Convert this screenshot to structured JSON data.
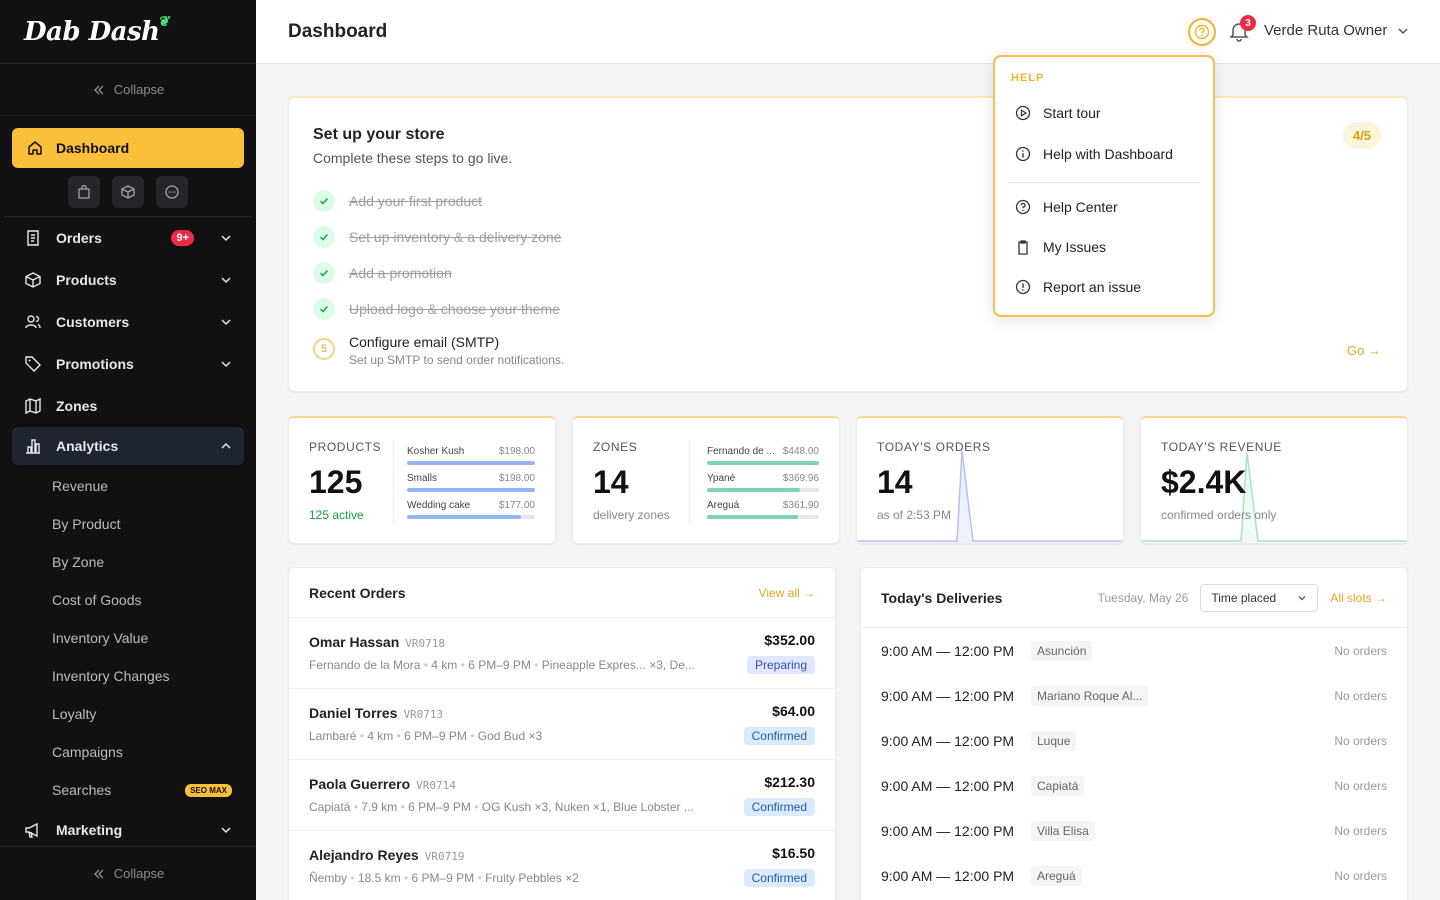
{
  "app": {
    "logo": "Dab Dash"
  },
  "sidebar": {
    "collapse_label": "Collapse",
    "dashboard_label": "Dashboard",
    "orders_label": "Orders",
    "orders_badge": "9+",
    "products_label": "Products",
    "customers_label": "Customers",
    "promotions_label": "Promotions",
    "zones_label": "Zones",
    "analytics_label": "Analytics",
    "analytics_items": [
      "Revenue",
      "By Product",
      "By Zone",
      "Cost of Goods",
      "Inventory Value",
      "Inventory Changes",
      "Loyalty",
      "Campaigns",
      "Searches"
    ],
    "searches_badge": "SEO MAX",
    "marketing_label": "Marketing"
  },
  "header": {
    "title": "Dashboard",
    "notifications_count": "3",
    "user": "Verde Ruta Owner"
  },
  "help_menu": {
    "header": "HELP",
    "items": [
      "Start tour",
      "Help with Dashboard",
      "Help Center",
      "My Issues",
      "Report an issue"
    ]
  },
  "setup": {
    "title": "Set up your store",
    "subtitle": "Complete these steps to go live.",
    "progress": "4/5",
    "steps": [
      "Add your first product",
      "Set up inventory & a delivery zone",
      "Add a promotion",
      "Upload logo & choose your theme"
    ],
    "pending_number": "5",
    "pending_title": "Configure email (SMTP)",
    "pending_desc": "Set up SMTP to send order notifications.",
    "go_label": "Go →"
  },
  "stats": {
    "products": {
      "caption": "PRODUCTS",
      "value": "125",
      "note": "125 active",
      "top": [
        {
          "name": "Kosher Kush",
          "value": "$198.00",
          "pct": 1.0
        },
        {
          "name": "Smalls",
          "value": "$198.00",
          "pct": 1.0
        },
        {
          "name": "Wedding cake",
          "value": "$177.00",
          "pct": 0.89
        }
      ]
    },
    "zones": {
      "caption": "ZONES",
      "value": "14",
      "note": "delivery zones",
      "top": [
        {
          "name": "Fernando de ...",
          "value": "$448.00",
          "pct": 1.0
        },
        {
          "name": "Ypané",
          "value": "$369.96",
          "pct": 0.83
        },
        {
          "name": "Areguá",
          "value": "$361.90",
          "pct": 0.81
        }
      ]
    },
    "orders": {
      "caption": "TODAY'S ORDERS",
      "value": "14",
      "note": "as of 2:53 PM"
    },
    "revenue": {
      "caption": "TODAY'S REVENUE",
      "value": "$2.4K",
      "note": "confirmed orders only"
    }
  },
  "colors": {
    "accent": "#fbbf3c",
    "products_bar": "#93b4f5",
    "zones_bar": "#7dd3b5",
    "orders_spark": "#a8b8f0",
    "revenue_spark": "#a6e3c8"
  },
  "recent_orders": {
    "title": "Recent Orders",
    "view_all": "View all →",
    "rows": [
      {
        "name": "Omar Hassan",
        "id": "VR0718",
        "zone": "Fernando de la Mora",
        "dist": "4 km",
        "slot": "6 PM–9 PM",
        "items": "Pineapple Expres... ×3, De...",
        "amount": "$352.00",
        "status": "Preparing"
      },
      {
        "name": "Daniel Torres",
        "id": "VR0713",
        "zone": "Lambaré",
        "dist": "4 km",
        "slot": "6 PM–9 PM",
        "items": "God Bud ×3",
        "amount": "$64.00",
        "status": "Confirmed"
      },
      {
        "name": "Paola Guerrero",
        "id": "VR0714",
        "zone": "Capiatá",
        "dist": "7.9 km",
        "slot": "6 PM–9 PM",
        "items": "OG Kush ×3, Nuken ×1, Blue Lobster ...",
        "amount": "$212.30",
        "status": "Confirmed"
      },
      {
        "name": "Alejandro Reyes",
        "id": "VR0719",
        "zone": "Ñemby",
        "dist": "18.5 km",
        "slot": "6 PM–9 PM",
        "items": "Fruity Pebbles ×2",
        "amount": "$16.50",
        "status": "Confirmed"
      }
    ]
  },
  "deliveries": {
    "title": "Today's Deliveries",
    "date": "Tuesday, May 26",
    "sort": "Time placed",
    "all_slots": "All slots →",
    "rows": [
      {
        "time": "9:00 AM — 12:00 PM",
        "zone": "Asunción",
        "status": "No orders"
      },
      {
        "time": "9:00 AM — 12:00 PM",
        "zone": "Mariano Roque Al...",
        "status": "No orders"
      },
      {
        "time": "9:00 AM — 12:00 PM",
        "zone": "Luque",
        "status": "No orders"
      },
      {
        "time": "9:00 AM — 12:00 PM",
        "zone": "Capiatá",
        "status": "No orders"
      },
      {
        "time": "9:00 AM — 12:00 PM",
        "zone": "Villa Elisa",
        "status": "No orders"
      },
      {
        "time": "9:00 AM — 12:00 PM",
        "zone": "Areguá",
        "status": "No orders"
      }
    ]
  }
}
